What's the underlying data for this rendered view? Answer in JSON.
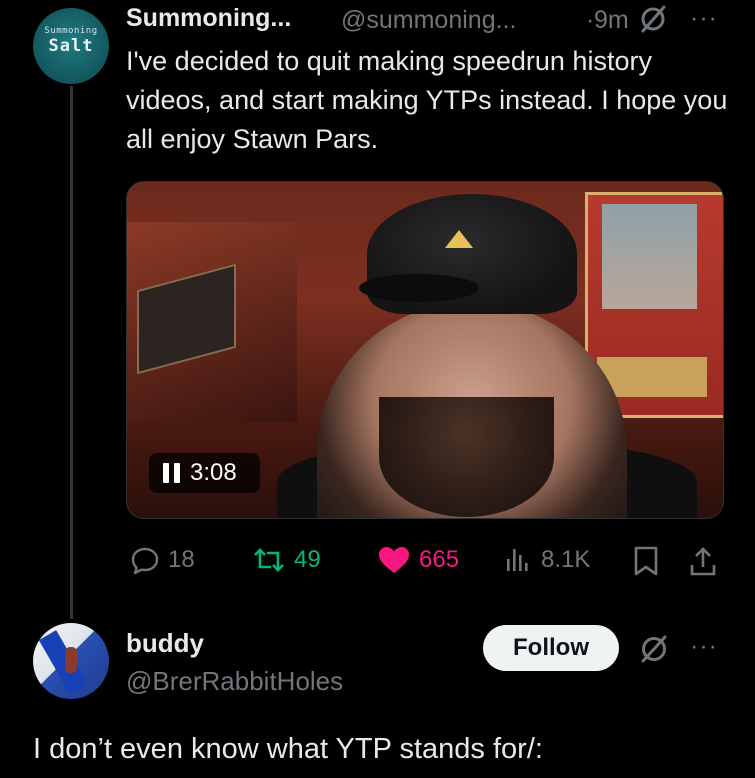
{
  "tweet1": {
    "avatar_top": "Summoning",
    "avatar_main": "Salt",
    "name": "Summoning...",
    "handle": "@summoning...",
    "separator": "·",
    "time": "9m",
    "more": "···",
    "text": "I've decided to quit making speedrun history videos, and start making YTPs instead. I hope you all enjoy Stawn Pars.",
    "video": {
      "time": "3:08",
      "state": "playing"
    },
    "actions": {
      "replies": "18",
      "reposts": "49",
      "likes": "665",
      "views": "8.1K"
    },
    "colors": {
      "repost": "#00ba7c",
      "like": "#f91880",
      "muted": "#71767b"
    }
  },
  "tweet2": {
    "name": "buddy",
    "handle": "@BrerRabbitHoles",
    "follow_label": "Follow",
    "more": "···",
    "text": "I don’t even know what YTP stands for/:"
  },
  "icons": [
    "grok-icon",
    "reply-icon",
    "repost-icon",
    "heart-icon",
    "views-icon",
    "bookmark-icon",
    "share-icon",
    "pause-icon"
  ]
}
